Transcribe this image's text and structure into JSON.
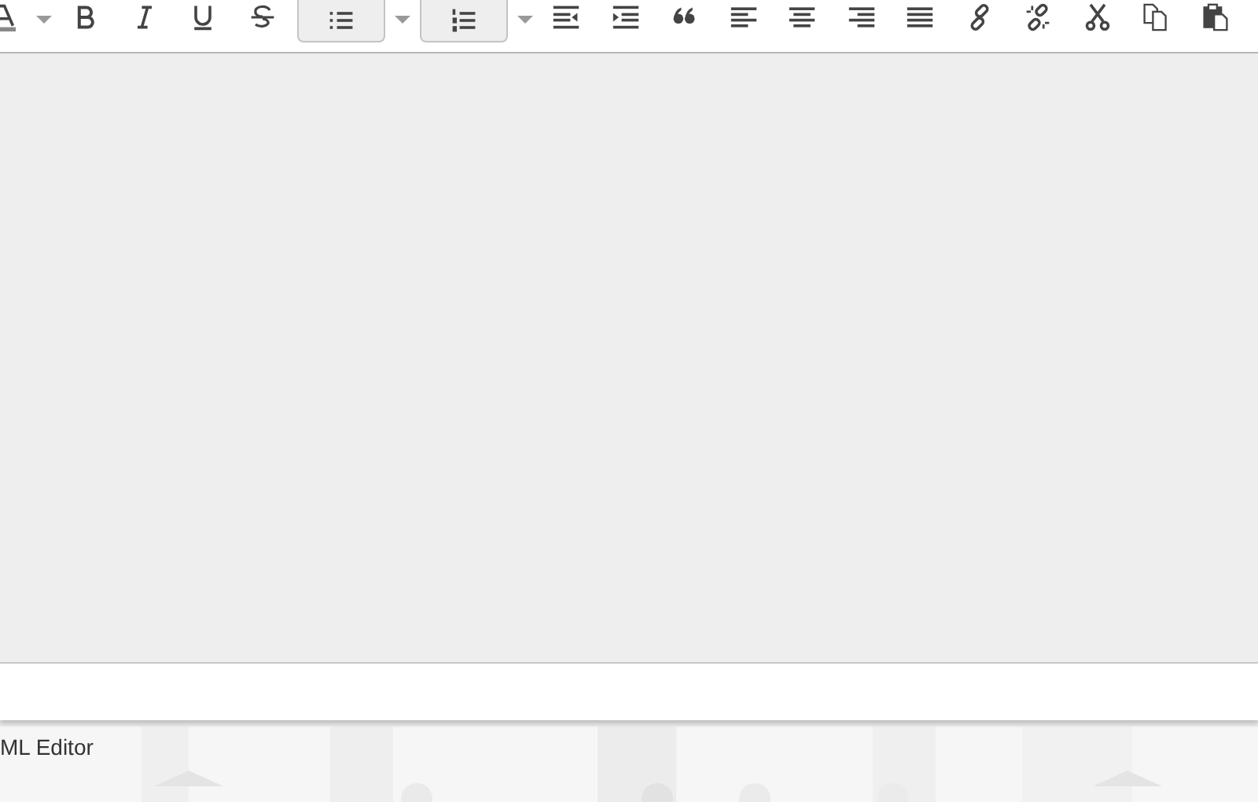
{
  "toolbar": [
    {
      "kind": "button",
      "active": false
    },
    {
      "kind": "caret"
    },
    {
      "kind": "button",
      "active": false
    },
    {
      "kind": "button",
      "active": false
    },
    {
      "kind": "button",
      "active": false
    },
    {
      "kind": "button",
      "active": false
    },
    {
      "kind": "wide-button",
      "active": true
    },
    {
      "kind": "caret"
    },
    {
      "kind": "wide-button",
      "active": true
    },
    {
      "kind": "caret"
    },
    {
      "kind": "button",
      "active": false
    },
    {
      "kind": "button",
      "active": false
    },
    {
      "kind": "button",
      "active": false
    },
    {
      "kind": "button",
      "active": false
    },
    {
      "kind": "button",
      "active": false
    },
    {
      "kind": "button",
      "active": false
    },
    {
      "kind": "button",
      "active": false
    },
    {
      "kind": "button",
      "active": false
    },
    {
      "kind": "button",
      "active": false
    },
    {
      "kind": "button",
      "active": false
    },
    {
      "kind": "button",
      "active": false
    },
    {
      "kind": "button",
      "active": false
    }
  ],
  "footer": {
    "label": "ML Editor"
  }
}
